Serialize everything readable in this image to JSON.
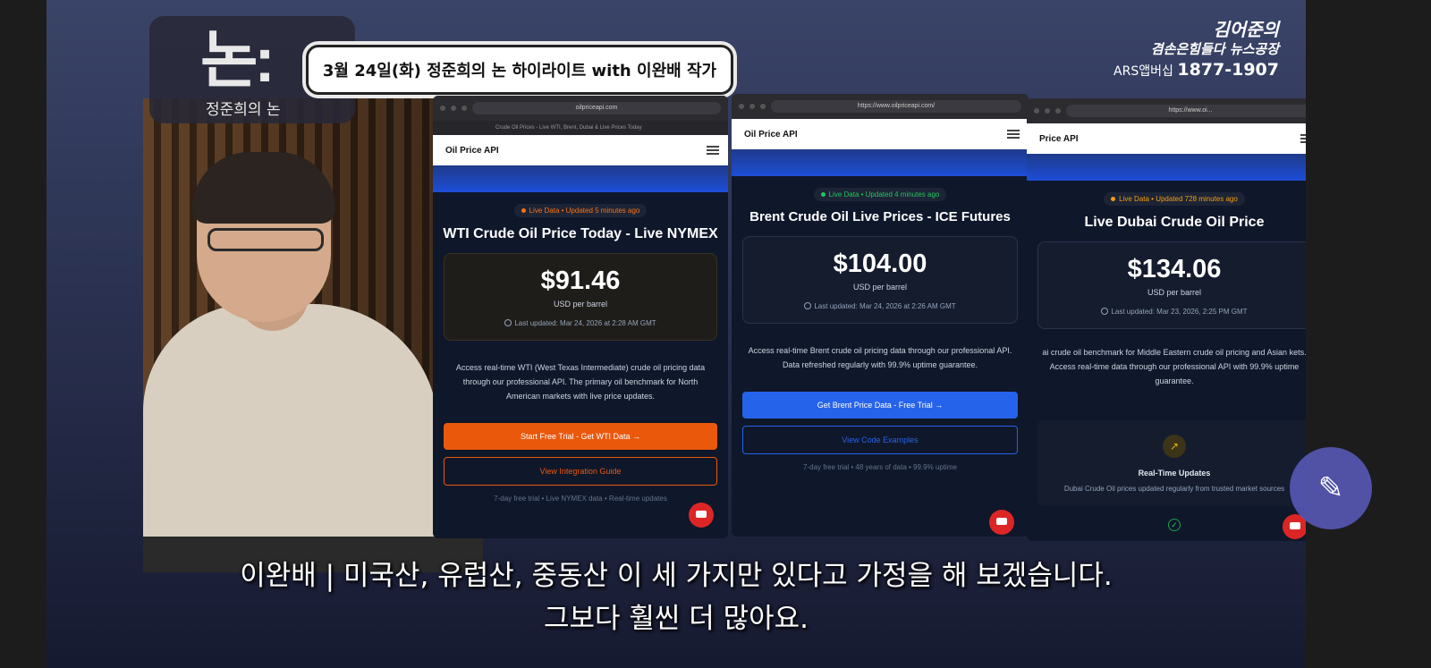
{
  "broadcast": {
    "logo_text": "논:",
    "logo_sub": "정준희의 논",
    "headline": "3월 24일(화) 정준희의 논 하이라이트 with 이완배 작가",
    "brand_title": "김어준의",
    "brand_subtitle": "겸손은힘들다 뉴스공장",
    "brand_phone_prefix": "ARS앱버십",
    "brand_phone": "1877-1907"
  },
  "windows": [
    {
      "url": "oilpriceapi.com",
      "tab_title": "Crude Oil Prices - Live WTI, Brent, Dubai & Live Prices Today",
      "app_title": "Oil Price API",
      "badge": "Live Data • Updated 5 minutes ago",
      "badge_color": "#f97316",
      "heading": "WTI Crude Oil Price Today - Live NYMEX",
      "price": "$91.46",
      "unit": "USD per barrel",
      "updated": "Last updated: Mar 24, 2026 at 2:28 AM GMT",
      "description": "Access real-time WTI (West Texas Intermediate) crude oil pricing data through our professional API. The primary oil benchmark for North American markets with live price updates.",
      "primary_button": "Start Free Trial - Get WTI Data →",
      "primary_color": "#ea580c",
      "outline_button": "View Integration Guide",
      "outline_color": "#ea580c",
      "footnote": "7-day free trial • Live NYMEX data • Real-time updates"
    },
    {
      "url": "https://www.oilpriceapi.com/",
      "tab_title": "",
      "app_title": "Oil Price API",
      "badge": "Live Data • Updated 4 minutes ago",
      "badge_color": "#22c55e",
      "heading": "Brent Crude Oil Live Prices - ICE Futures",
      "price": "$104.00",
      "unit": "USD per barrel",
      "updated": "Last updated: Mar 24, 2026 at 2:26 AM GMT",
      "description": "Access real-time Brent crude oil pricing data through our professional API. Data refreshed regularly with 99.9% uptime guarantee.",
      "primary_button": "Get Brent Price Data - Free Trial →",
      "primary_color": "#2563eb",
      "outline_button": "View Code Examples",
      "outline_color": "#2563eb",
      "footnote": "7-day free trial • 48 years of data • 99.9% uptime"
    },
    {
      "url": "https://www.oi...",
      "tab_title": "",
      "app_title": "Price API",
      "badge": "Live Data • Updated 728 minutes ago",
      "badge_color": "#f59e0b",
      "heading": "Live Dubai Crude Oil Price",
      "price": "$134.06",
      "unit": "USD per barrel",
      "updated": "Last updated: Mar 23, 2026, 2:25 PM GMT",
      "description": "ai crude oil benchmark for Middle Eastern crude oil pricing and Asian kets. Access real-time data through our professional API with 99.9% uptime guarantee.",
      "feature_icon": "trend-up-icon",
      "feature_title": "Real-Time Updates",
      "feature_text": "Dubai Crude Oil prices updated regularly from trusted market sources"
    }
  ],
  "subtitles": {
    "line1": "이완배 | 미국산, 유럽산, 중동산 이 세 가지만 있다고 가정을 해 보겠습니다.",
    "line2": "그보다 훨씬 더 많아요."
  },
  "fab_icon": "pen-icon"
}
